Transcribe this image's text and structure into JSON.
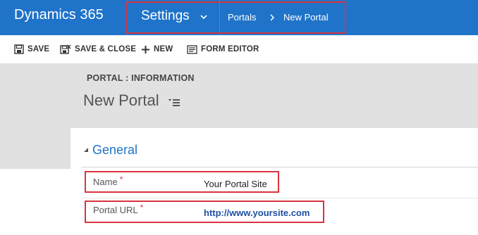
{
  "nav": {
    "app_title": "Dynamics 365",
    "area": "Settings",
    "breadcrumb": [
      "Portals",
      "New Portal"
    ]
  },
  "toolbar": {
    "save_label": "SAVE",
    "save_close_label": "SAVE & CLOSE",
    "new_label": "NEW",
    "form_editor_label": "FORM EDITOR"
  },
  "header": {
    "entity_label": "PORTAL : INFORMATION",
    "record_title": "New Portal"
  },
  "section": {
    "title": "General"
  },
  "fields": {
    "name": {
      "label": "Name",
      "required_marker": "*",
      "value": "Your Portal Site"
    },
    "portal_url": {
      "label": "Portal URL",
      "required_marker": "*",
      "value": "http://www.yoursite.com"
    }
  },
  "colors": {
    "nav_bg": "#1f73c9",
    "highlight": "#d9333f",
    "header_bg": "#e1e1e1",
    "section_title": "#1f73c9",
    "link": "#1e4fa3"
  },
  "icons": {
    "area_dropdown": "chevron-down-icon",
    "breadcrumb_sep": "chevron-right-icon",
    "save": "save-icon",
    "save_close": "save-close-icon",
    "new": "plus-icon",
    "form_editor": "form-editor-icon",
    "form_menu": "form-menu-icon",
    "section_collapse": "triangle-collapse-icon"
  }
}
